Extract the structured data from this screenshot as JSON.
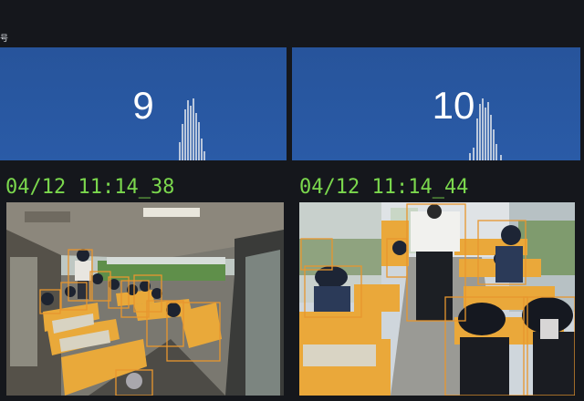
{
  "header": {
    "label": "号"
  },
  "panels": [
    {
      "count": "9"
    },
    {
      "count": "10"
    }
  ],
  "cameras": [
    {
      "timestamp": "04/12 11:14_38"
    },
    {
      "timestamp": "04/12 11:14_44"
    }
  ],
  "colors": {
    "background": "#15171c",
    "panel_blue": "#2a5ba7",
    "timestamp_green": "#7bd84d",
    "detection_box": "#e8962e"
  }
}
